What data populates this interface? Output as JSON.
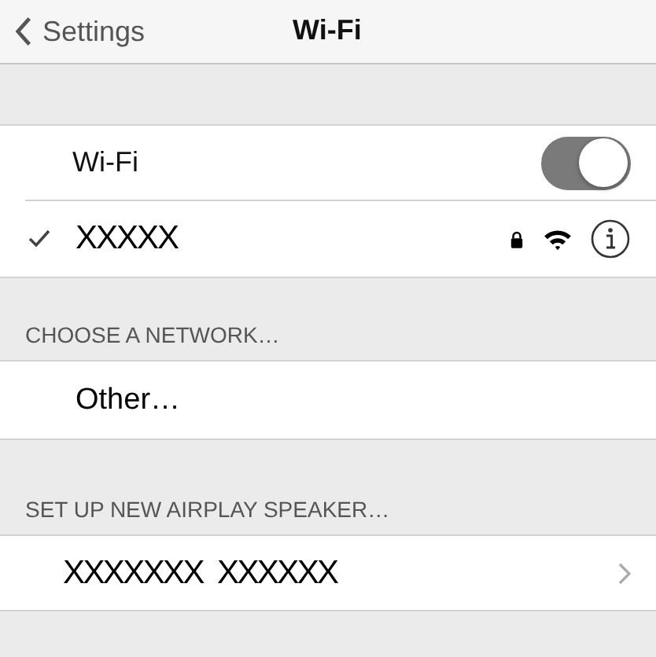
{
  "nav": {
    "back": "Settings",
    "title": "Wi-Fi"
  },
  "wifi": {
    "label": "Wi-Fi",
    "on": true
  },
  "current": {
    "name": "XXXXX",
    "connected": true,
    "secured": true
  },
  "sections": [
    {
      "header": "CHOOSE A NETWORK…",
      "rows": [
        {
          "label": "Other…",
          "kind": "plain"
        }
      ]
    },
    {
      "header": "SET UP NEW AIRPLAY SPEAKER…",
      "rows": [
        {
          "label": "XXXXXXX  XXXXXX",
          "kind": "disclosure"
        }
      ]
    }
  ]
}
